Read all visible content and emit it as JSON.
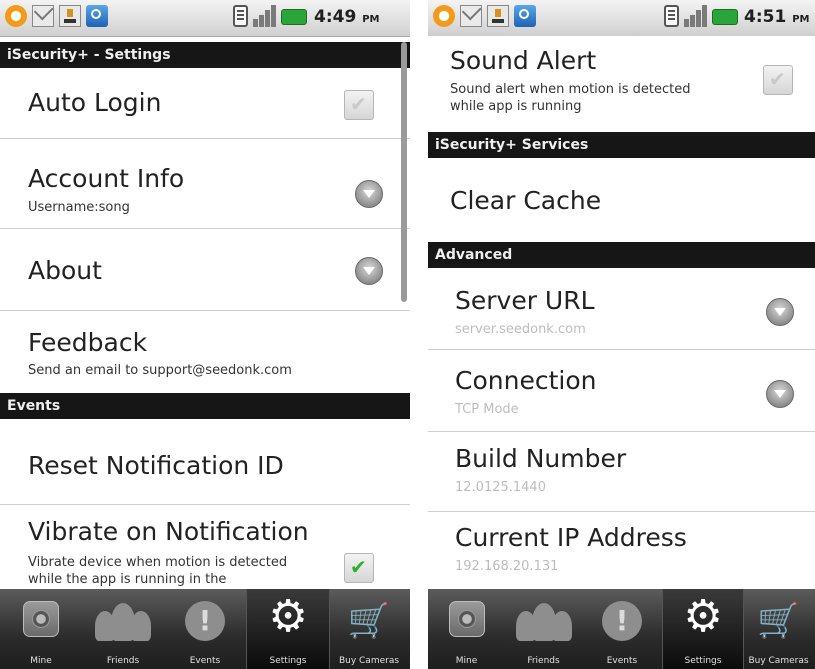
{
  "left": {
    "status": {
      "time": "4:49",
      "ampm": "PM"
    },
    "title_header": "iSecurity+ - Settings",
    "rows": [
      {
        "title": "Auto Login",
        "subtitle": ""
      },
      {
        "title": "Account Info",
        "subtitle": "Username:song"
      },
      {
        "title": "About",
        "subtitle": ""
      },
      {
        "title": "Feedback",
        "subtitle": "Send an email to support@seedonk.com"
      }
    ],
    "events_header": "Events",
    "event_rows": [
      {
        "title": "Reset Notification ID",
        "subtitle": ""
      },
      {
        "title": "Vibrate on Notification",
        "subtitle": "Vibrate device when motion is detected",
        "subtitle2": "while the app is running in the"
      }
    ],
    "checkbox_states": {
      "auto_login": false,
      "vibrate": true
    }
  },
  "right": {
    "status": {
      "time": "4:51",
      "ampm": "PM"
    },
    "sound_alert": {
      "title": "Sound Alert",
      "subtitle": "Sound alert when motion is detected",
      "subtitle2": "while app is running",
      "checked": false
    },
    "services_header": "iSecurity+ Services",
    "clear_cache": "Clear Cache",
    "advanced_header": "Advanced",
    "advanced_rows": [
      {
        "title": "Server URL",
        "value": "server.seedonk.com"
      },
      {
        "title": "Connection",
        "value": "TCP Mode"
      },
      {
        "title": "Build Number",
        "value": "12.0125.1440"
      },
      {
        "title": "Current IP Address",
        "value": "192.168.20.131"
      }
    ]
  },
  "tabs": [
    "Mine",
    "Friends",
    "Events",
    "Settings",
    "Buy Cameras"
  ],
  "active_tab": "Settings",
  "icons": {
    "status": [
      "notification-icon",
      "gmail-icon",
      "download-icon",
      "chat-icon",
      "vibrate-icon",
      "signal-icon",
      "battery-icon"
    ],
    "tabs": [
      "camera-icon",
      "friends-icon",
      "alert-icon",
      "gear-icon",
      "cart-icon"
    ]
  },
  "colors": {
    "section_header": "#161616",
    "check_green": "#2fae2f",
    "battery": "#2aa53a",
    "status_bar": "#d9d9d9"
  }
}
